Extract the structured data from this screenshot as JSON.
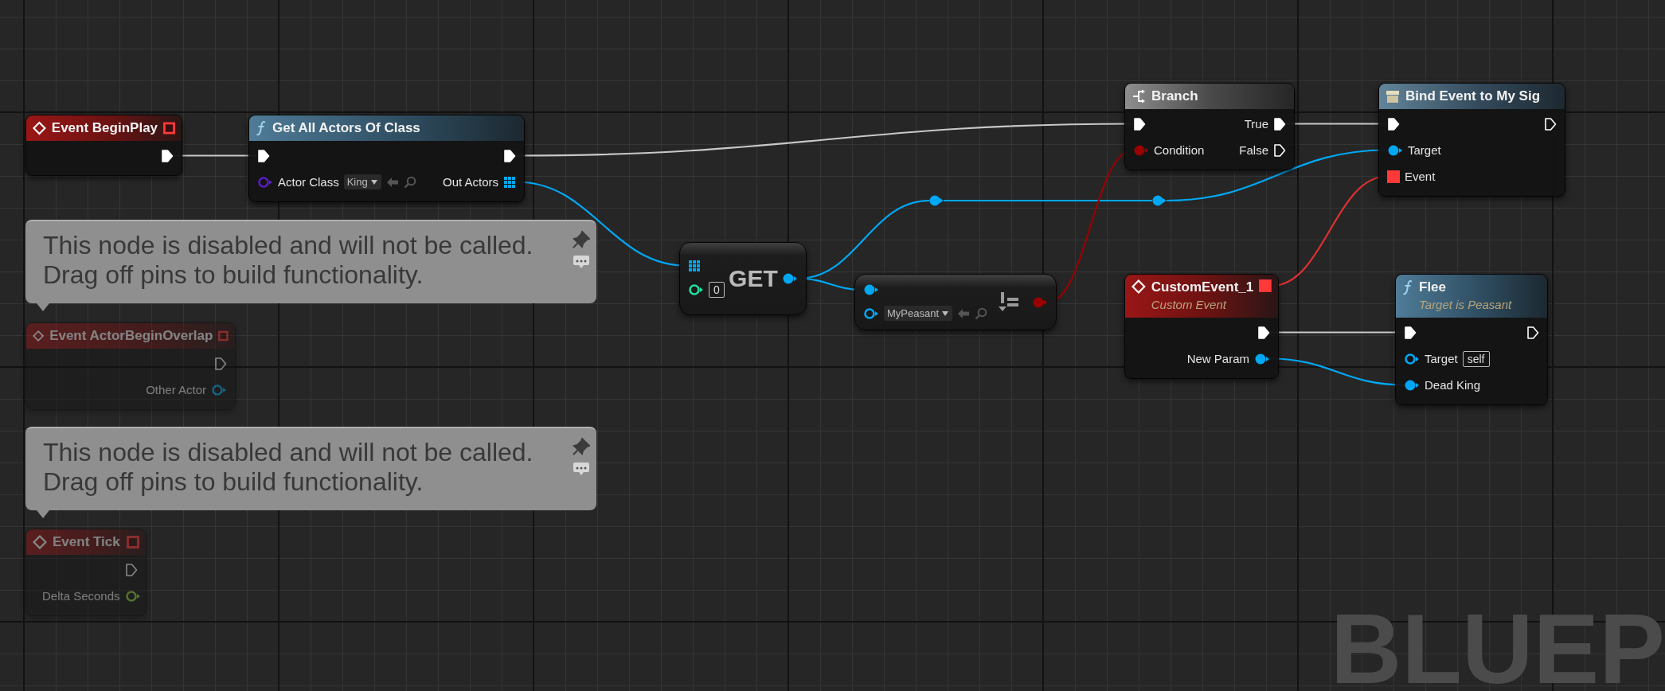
{
  "nodes": [
    {
      "kind": "event",
      "title": "Event BeginPlay",
      "disabled": false,
      "header_pin": {
        "kind": "delegate",
        "connected": false
      },
      "outputs": [
        {
          "kind": "exec",
          "connected": true
        }
      ]
    },
    {
      "kind": "function",
      "title": "Get All Actors Of Class",
      "disabled": false,
      "inputs": [
        {
          "kind": "exec",
          "connected": true
        },
        {
          "kind": "class",
          "label": "Actor Class",
          "connected": false,
          "default": {
            "kind": "dropdown",
            "value": "King"
          }
        }
      ],
      "outputs": [
        {
          "kind": "exec",
          "connected": true
        },
        {
          "kind": "array",
          "label": "Out Actors",
          "connected": true
        }
      ]
    },
    {
      "kind": "event",
      "title": "Event ActorBeginOverlap",
      "disabled": true,
      "header_pin": {
        "kind": "delegate",
        "connected": false
      },
      "outputs": [
        {
          "kind": "exec",
          "connected": false
        },
        {
          "kind": "object",
          "label": "Other Actor",
          "connected": false
        }
      ]
    },
    {
      "kind": "event",
      "title": "Event Tick",
      "disabled": true,
      "header_pin": {
        "kind": "delegate",
        "connected": false
      },
      "outputs": [
        {
          "kind": "exec",
          "connected": false
        },
        {
          "kind": "float",
          "label": "Delta Seconds",
          "connected": false
        }
      ]
    },
    {
      "kind": "get",
      "title": "GET",
      "disabled": false,
      "inputs": [
        {
          "kind": "array",
          "connected": true
        },
        {
          "kind": "int",
          "connected": false,
          "default": {
            "kind": "box",
            "value": "0"
          }
        }
      ],
      "outputs": [
        {
          "kind": "object",
          "connected": true
        }
      ]
    },
    {
      "kind": "compare",
      "disabled": false,
      "inputs": [
        {
          "kind": "object",
          "connected": true
        },
        {
          "kind": "object",
          "connected": false,
          "default": {
            "kind": "dropdown",
            "value": "MyPeasant"
          }
        }
      ],
      "outputs": [
        {
          "kind": "bool",
          "connected": true
        }
      ]
    },
    {
      "kind": "branch",
      "title": "Branch",
      "disabled": false,
      "inputs": [
        {
          "kind": "exec",
          "connected": true
        },
        {
          "kind": "bool",
          "label": "Condition",
          "connected": true
        }
      ],
      "outputs": [
        {
          "kind": "exec",
          "label": "True",
          "connected": true
        },
        {
          "kind": "exec",
          "label": "False",
          "connected": false
        }
      ]
    },
    {
      "kind": "custom_event",
      "title": "CustomEvent_1",
      "subtitle": "Custom Event",
      "disabled": false,
      "header_pin": {
        "kind": "delegate",
        "connected": true
      },
      "outputs": [
        {
          "kind": "exec",
          "connected": true
        },
        {
          "kind": "object",
          "label": "New Param",
          "connected": true
        }
      ]
    },
    {
      "kind": "bind",
      "title": "Bind Event to My Sig",
      "disabled": false,
      "inputs": [
        {
          "kind": "exec",
          "connected": true
        },
        {
          "kind": "object",
          "label": "Target",
          "connected": true
        },
        {
          "kind": "delegate",
          "label": "Event",
          "connected": true
        }
      ],
      "outputs": [
        {
          "kind": "exec",
          "connected": false
        }
      ]
    },
    {
      "kind": "function",
      "title": "Flee",
      "subtitle": "Target is Peasant",
      "disabled": false,
      "inputs": [
        {
          "kind": "exec",
          "connected": true
        },
        {
          "kind": "object",
          "label": "Target",
          "connected": false,
          "default": {
            "kind": "box",
            "value": "self"
          }
        },
        {
          "kind": "object",
          "label": "Dead King",
          "connected": true
        }
      ],
      "outputs": [
        {
          "kind": "exec",
          "connected": false
        }
      ]
    }
  ],
  "comments": [
    {
      "text": "This node is disabled and will not be called.\nDrag off pins to build functionality."
    },
    {
      "text": "This node is disabled and will not be called.\nDrag off pins to build functionality."
    }
  ],
  "canvas_label": "BLUEP"
}
